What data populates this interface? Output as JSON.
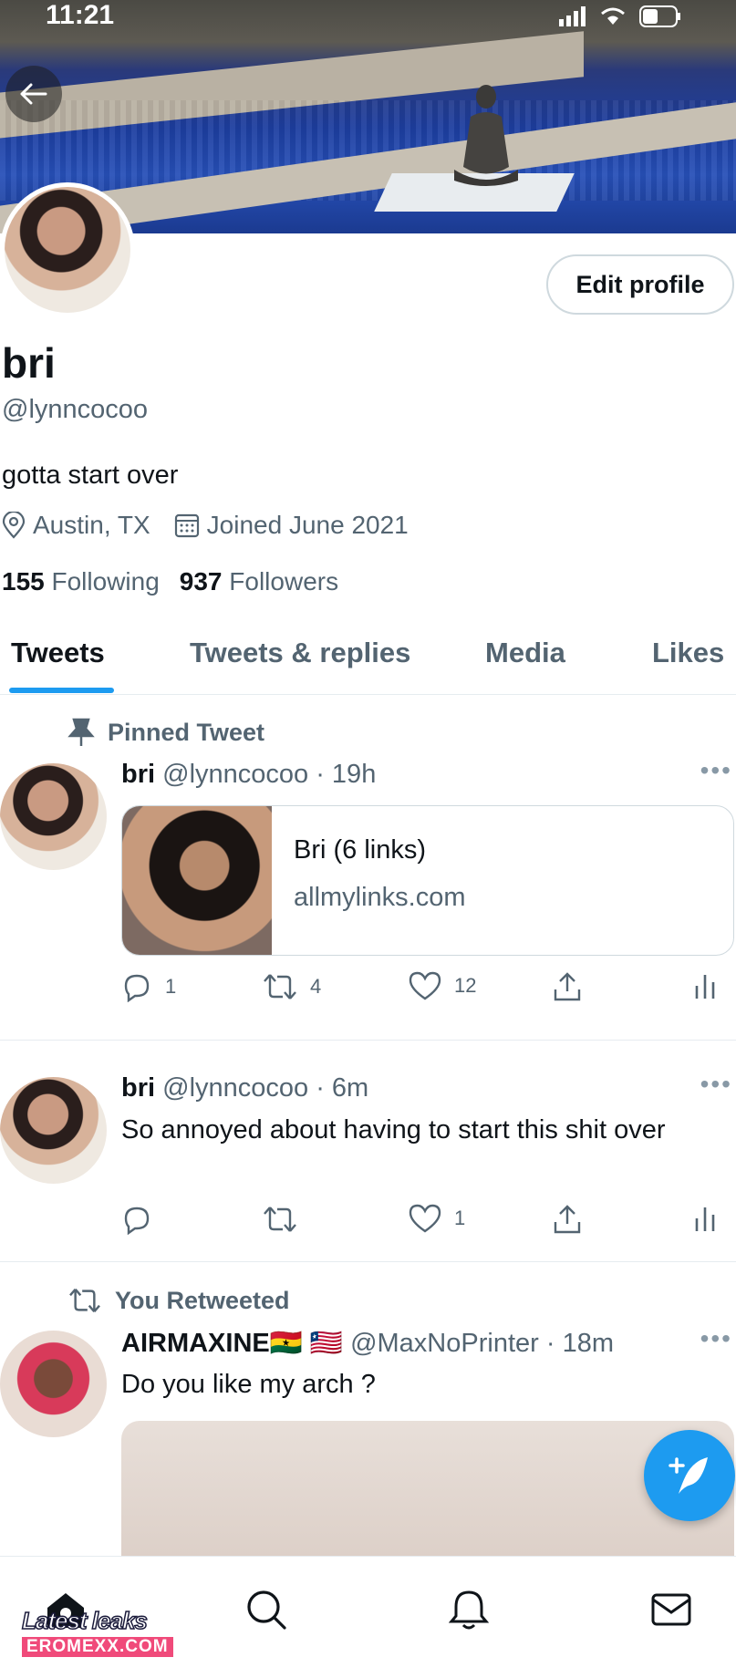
{
  "status_bar": {
    "time": "11:21"
  },
  "profile": {
    "name": "bri",
    "handle": "@lynncocoo",
    "bio": "gotta start over",
    "location": "Austin, TX",
    "joined": "Joined June 2021",
    "following_count": "155",
    "following_label": "Following",
    "followers_count": "937",
    "followers_label": "Followers",
    "edit_label": "Edit profile"
  },
  "tabs": [
    "Tweets",
    "Tweets & replies",
    "Media",
    "Likes"
  ],
  "tweets": [
    {
      "context": "Pinned Tweet",
      "name": "bri",
      "handle": "@lynncocoo",
      "time": "· 19h",
      "card_title": "Bri (6 links)",
      "card_url": "allmylinks.com",
      "replies": "1",
      "retweets": "4",
      "likes": "12"
    },
    {
      "name": "bri",
      "handle": "@lynncocoo",
      "time": "· 6m",
      "text": "So annoyed about having to start this shit over",
      "replies": "",
      "retweets": "",
      "likes": "1"
    },
    {
      "context": "You Retweeted",
      "name": "AIRMAXINE🇬🇭 🇱🇷",
      "handle": "@MaxNoPrinter",
      "time": "· 18m",
      "text": "Do you like my arch ?"
    }
  ],
  "watermark": {
    "line1": "Latest leaks",
    "line2": "EROMEXX.COM"
  },
  "colors": {
    "accent": "#1d9bf0",
    "text": "#0f1419",
    "muted": "#536471"
  },
  "icons": [
    "back-arrow-icon",
    "location-icon",
    "calendar-icon",
    "pin-icon",
    "retweet-icon",
    "reply-icon",
    "like-icon",
    "share-icon",
    "analytics-icon",
    "compose-icon",
    "home-icon",
    "search-icon",
    "bell-icon",
    "mail-icon"
  ]
}
